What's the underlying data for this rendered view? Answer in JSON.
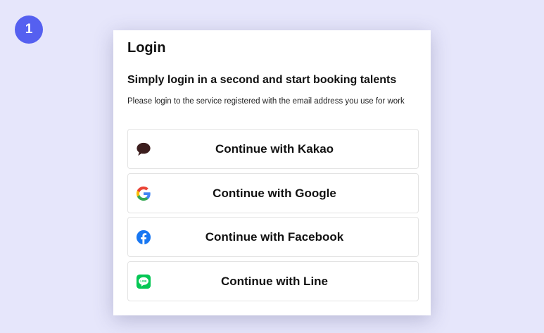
{
  "step_badge": {
    "number": "1",
    "color": "#5560f0"
  },
  "login": {
    "title": "Login",
    "subtitle": "Simply login in a second and start booking talents",
    "description": "Please login to the service registered with the email address you use for work",
    "buttons": [
      {
        "id": "kakao",
        "label": "Continue with Kakao",
        "icon": "kakao-speech-bubble-icon",
        "icon_color": "#3c1e1e"
      },
      {
        "id": "google",
        "label": "Continue with Google",
        "icon": "google-g-icon",
        "icon_colors": [
          "#4285f4",
          "#ea4335",
          "#fbbc05",
          "#34a853"
        ]
      },
      {
        "id": "facebook",
        "label": "Continue with Facebook",
        "icon": "facebook-icon",
        "icon_color": "#1877f2"
      },
      {
        "id": "line",
        "label": "Continue with Line",
        "icon": "line-icon",
        "icon_color": "#06c755",
        "icon_text": "LINE"
      }
    ]
  }
}
